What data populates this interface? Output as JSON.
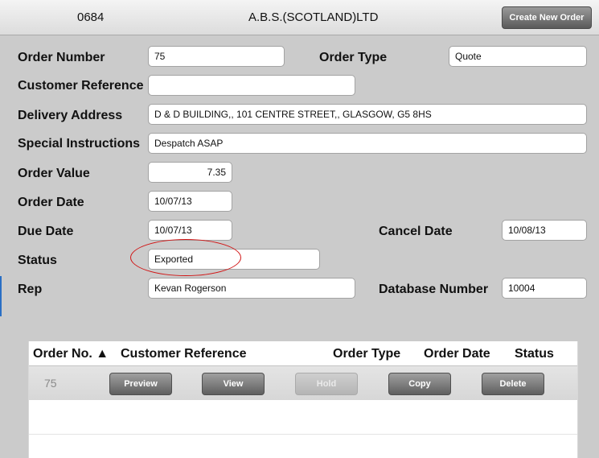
{
  "header": {
    "code": "0684",
    "company": "A.B.S.(SCOTLAND)LTD",
    "create_label": "Create New Order"
  },
  "form": {
    "order_number": {
      "label": "Order Number",
      "value": "75"
    },
    "order_type": {
      "label": "Order Type",
      "value": "Quote"
    },
    "customer_reference": {
      "label": "Customer Reference",
      "value": ""
    },
    "delivery_address": {
      "label": "Delivery Address",
      "value": "D & D BUILDING,, 101 CENTRE STREET,, GLASGOW, G5 8HS"
    },
    "special_instructions": {
      "label": "Special Instructions",
      "value": "Despatch ASAP"
    },
    "order_value": {
      "label": "Order Value",
      "value": "7.35"
    },
    "order_date": {
      "label": "Order Date",
      "value": "10/07/13"
    },
    "due_date": {
      "label": "Due Date",
      "value": "10/07/13"
    },
    "cancel_date": {
      "label": "Cancel Date",
      "value": "10/08/13"
    },
    "status": {
      "label": "Status",
      "value": "Exported"
    },
    "rep": {
      "label": "Rep",
      "value": "Kevan Rogerson"
    },
    "database_number": {
      "label": "Database Number",
      "value": "10004"
    }
  },
  "table": {
    "headers": [
      "Order No. ▲",
      "Customer Reference",
      "Order Type",
      "Order Date",
      "Status"
    ],
    "rows": [
      {
        "order_no": "75",
        "actions": {
          "preview": "Preview",
          "view": "View",
          "hold": "Hold",
          "copy": "Copy",
          "delete": "Delete"
        }
      }
    ]
  },
  "colors": {
    "background": "#cbcbcb",
    "annotation": "#d11414",
    "button": "#6e6e6e"
  }
}
